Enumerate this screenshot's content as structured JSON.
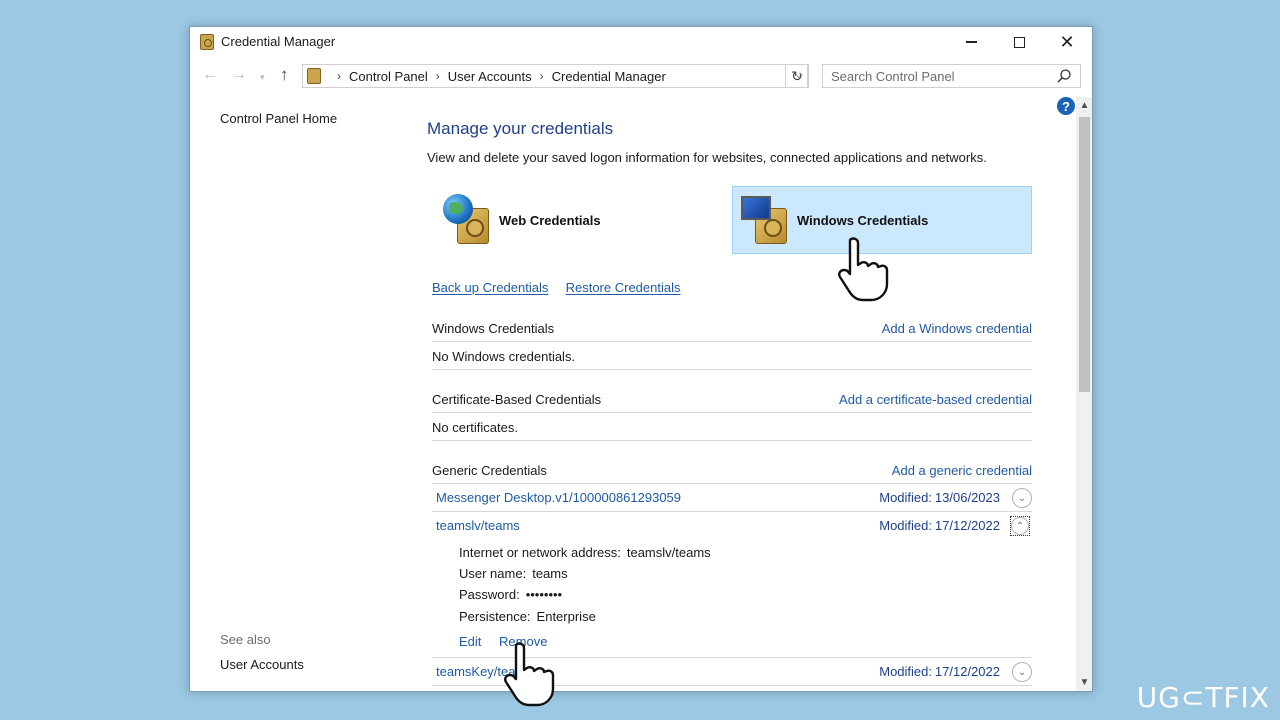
{
  "window": {
    "title": "Credential Manager"
  },
  "navigation": {
    "breadcrumbs": [
      "Control Panel",
      "User Accounts",
      "Credential Manager"
    ],
    "search_placeholder": "Search Control Panel"
  },
  "sidebar": {
    "home_link": "Control Panel Home",
    "see_also_label": "See also",
    "see_also_items": [
      "User Accounts"
    ]
  },
  "main": {
    "title": "Manage your credentials",
    "description": "View and delete your saved logon information for websites, connected applications and networks.",
    "tiles": [
      {
        "label": "Web Credentials",
        "icon": "web-vault-icon",
        "selected": false
      },
      {
        "label": "Windows Credentials",
        "icon": "windows-vault-icon",
        "selected": true
      }
    ],
    "backup_link": "Back up Credentials",
    "restore_link": "Restore Credentials"
  },
  "sections": {
    "windows": {
      "title": "Windows Credentials",
      "add_link": "Add a Windows credential",
      "empty_text": "No Windows credentials."
    },
    "certificate": {
      "title": "Certificate-Based Credentials",
      "add_link": "Add a certificate-based credential",
      "empty_text": "No certificates."
    },
    "generic": {
      "title": "Generic Credentials",
      "add_link": "Add a generic credential",
      "modified_label": "Modified:",
      "items": [
        {
          "name": "Messenger Desktop.v1/100000861293059",
          "modified": "13/06/2023",
          "expanded": false
        },
        {
          "name": "teamslv/teams",
          "modified": "17/12/2022",
          "expanded": true
        },
        {
          "name": "teamsKey/tea",
          "modified": "17/12/2022",
          "expanded": false
        }
      ],
      "detail": {
        "address_label": "Internet or network address:",
        "address_value": "teamslv/teams",
        "username_label": "User name:",
        "username_value": "teams",
        "password_label": "Password:",
        "password_value": "••••••••",
        "persistence_label": "Persistence:",
        "persistence_value": "Enterprise",
        "edit_link": "Edit",
        "remove_link": "Remove"
      }
    }
  },
  "watermark": "UG⊂TFIX",
  "colors": {
    "link": "#1f5aa6",
    "title": "#1e3f8b",
    "selected_tile": "#cce8ff",
    "desktop": "#9cc8e4"
  }
}
